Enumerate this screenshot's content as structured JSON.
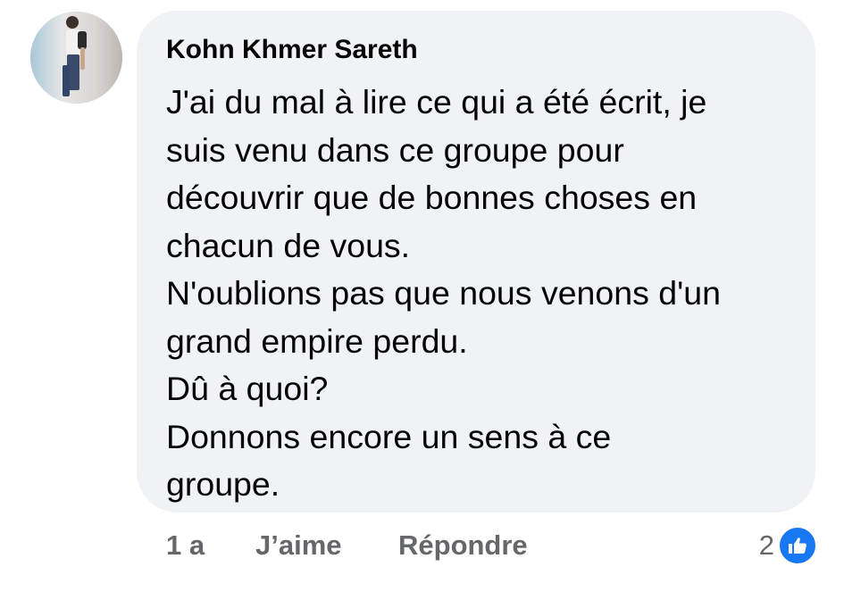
{
  "comment": {
    "author": "Kohn Khmer Sareth",
    "lines": [
      "J'ai du mal à lire ce qui a été écrit, je",
      "suis venu dans ce groupe pour",
      "découvrir que de bonnes choses en",
      "chacun de vous.",
      "N'oublions pas que nous venons d'un",
      "grand empire perdu.",
      "Dû à quoi?",
      "Donnons encore un sens à ce",
      "groupe."
    ],
    "avatar_icon": "profile-photo"
  },
  "actions": {
    "time": "1 a",
    "like_label": "J’aime",
    "reply_label": "Répondre"
  },
  "reactions": {
    "count": "2",
    "icon": "like-thumb-icon",
    "badge_color": "#1877f2"
  },
  "colors": {
    "bubble": "#f0f2f5",
    "text": "#050505",
    "secondary_text": "#65676b"
  }
}
